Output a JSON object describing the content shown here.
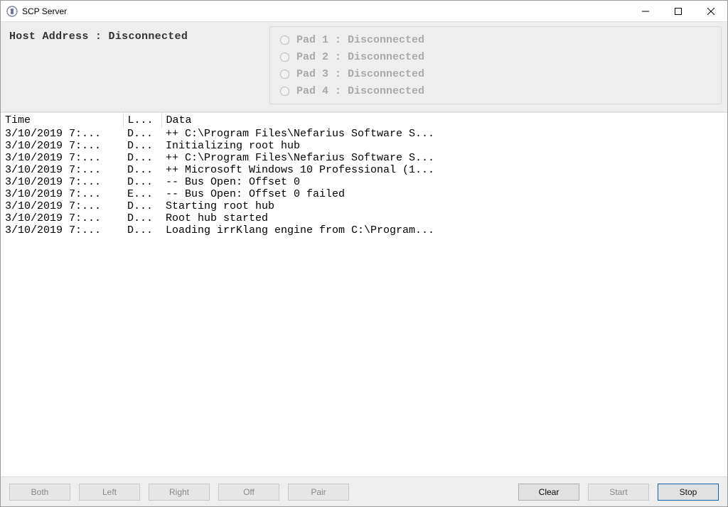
{
  "window": {
    "title": "SCP Server"
  },
  "host": {
    "label": "Host Address :",
    "value": "Disconnected"
  },
  "pads": [
    {
      "label": "Pad 1 : Disconnected"
    },
    {
      "label": "Pad 2 : Disconnected"
    },
    {
      "label": "Pad 3 : Disconnected"
    },
    {
      "label": "Pad 4 : Disconnected"
    }
  ],
  "log": {
    "headers": {
      "time": "Time",
      "level": "L...",
      "data": "Data"
    },
    "rows": [
      {
        "time": "3/10/2019 7:...",
        "level": "D...",
        "data": "++ C:\\Program Files\\Nefarius Software S..."
      },
      {
        "time": "3/10/2019 7:...",
        "level": "D...",
        "data": "Initializing root hub"
      },
      {
        "time": "3/10/2019 7:...",
        "level": "D...",
        "data": "++ C:\\Program Files\\Nefarius Software S..."
      },
      {
        "time": "3/10/2019 7:...",
        "level": "D...",
        "data": "++ Microsoft Windows 10 Professional (1..."
      },
      {
        "time": "3/10/2019 7:...",
        "level": "D...",
        "data": "-- Bus Open: Offset 0"
      },
      {
        "time": "3/10/2019 7:...",
        "level": "E...",
        "data": "-- Bus Open: Offset 0 failed"
      },
      {
        "time": "3/10/2019 7:...",
        "level": "D...",
        "data": "Starting root hub"
      },
      {
        "time": "3/10/2019 7:...",
        "level": "D...",
        "data": "Root hub started"
      },
      {
        "time": "3/10/2019 7:...",
        "level": "D...",
        "data": "Loading irrKlang engine from C:\\Program..."
      }
    ]
  },
  "buttons": {
    "both": "Both",
    "left": "Left",
    "right": "Right",
    "off": "Off",
    "pair": "Pair",
    "clear": "Clear",
    "start": "Start",
    "stop": "Stop"
  }
}
